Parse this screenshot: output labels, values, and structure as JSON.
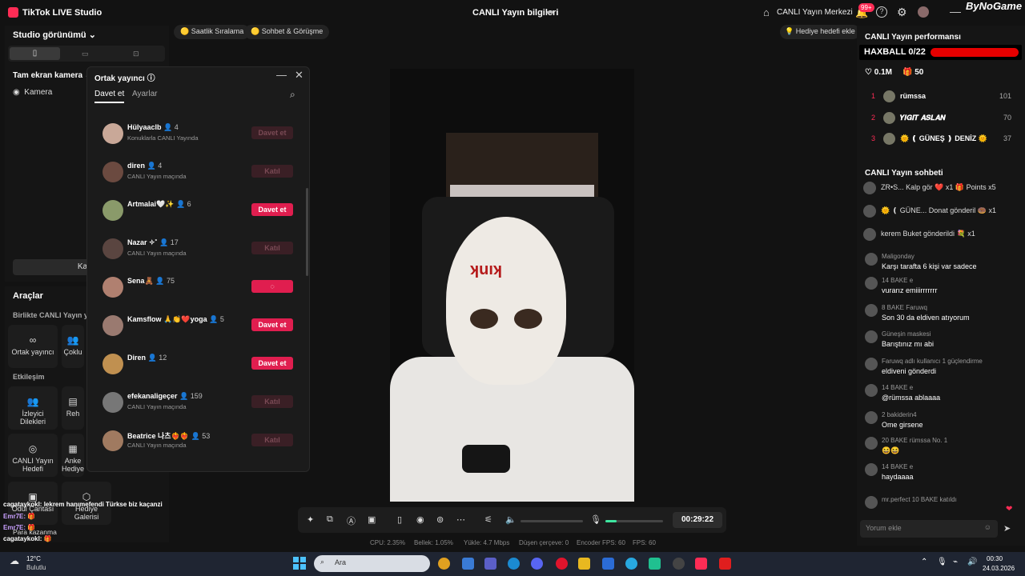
{
  "app": {
    "title": "TikTok LIVE Studio",
    "center_title": "CANLI Yayın bilgileri",
    "live_center": "CANLI Yayın Merkezi",
    "notif_badge": "99+",
    "watermark": "ByNoGame"
  },
  "left": {
    "studio_view": "Studio görünümü",
    "fullscreen_cam": "Tam ekran kamera",
    "camera": "Kamera",
    "kaynak_button": "Kaynak",
    "tools_title": "Araçlar",
    "tools_sub1": "Birlikte CANLI Yayın yap",
    "tools_sub2": "Etkileşim",
    "tool_cohost": "Ortak yayıncı",
    "tool_multi": "Çoklu",
    "tool_requests_1": "İzleyici",
    "tool_requests_2": "Dilekleri",
    "tool_reh": "Reh",
    "tool_goal_1": "CANLI Yayın",
    "tool_goal_2": "Hedefi",
    "tool_ank_1": "Anke",
    "tool_ank_2": "Hediye",
    "tool_bag": "Ödül Çantası",
    "tool_gallery_1": "Hediye",
    "tool_gallery_2": "Galerisi",
    "tool_earn": "Para kazanma"
  },
  "overlay_chat": [
    "cagataykokl: lekrem hanımefendi Türkse biz kaçanzi",
    "Emr7E: 🎁",
    "Emr7E: 🎁",
    "cagataykokl: 🎁"
  ],
  "cohost": {
    "title": "Ortak yayıncı",
    "tab_invite": "Davet et",
    "tab_settings": "Ayarlar",
    "rows": [
      {
        "name": "Hülyaaclb",
        "count": "4",
        "status": "Konuklarla CANLI Yayında",
        "button": "Davet et",
        "enabled": false,
        "color": "#c9a898"
      },
      {
        "name": "diren",
        "count": "4",
        "status": "CANLI Yayın maçında",
        "button": "Katıl",
        "enabled": false,
        "color": "#6b4a40"
      },
      {
        "name": "Artmalai🤍✨",
        "count": "6",
        "status": "",
        "button": "Davet et",
        "enabled": true,
        "color": "#8a9a6a"
      },
      {
        "name": "Nazar ✧˚",
        "count": "17",
        "status": "CANLI Yayın maçında",
        "button": "Katıl",
        "enabled": false,
        "color": "#5a4540"
      },
      {
        "name": "Sena🧸",
        "count": "75",
        "status": "",
        "button": "◌",
        "enabled": true,
        "color": "#b08070"
      },
      {
        "name": "Kamsflow 🙏👏❤️yoga",
        "count": "5",
        "status": "",
        "button": "Davet et",
        "enabled": true,
        "color": "#9a7a70"
      },
      {
        "name": "Diren",
        "count": "12",
        "status": "",
        "button": "Davet et",
        "enabled": true,
        "color": "#c09050"
      },
      {
        "name": "efekanaligeçer",
        "count": "159",
        "status": "CANLI Yayın maçında",
        "button": "Katıl",
        "enabled": false,
        "color": "#777"
      },
      {
        "name": "Beatrice 나츠❤️‍🔥❤️‍🔥",
        "count": "53",
        "status": "CANLI Yayın maçında",
        "button": "Katıl",
        "enabled": false,
        "color": "#a07a60"
      }
    ]
  },
  "pills": {
    "ranking": "Saatlik Sıralama",
    "chat": "Sohbet & Görüşme",
    "gift_goal": "Hediye hedefi ekle"
  },
  "video": {
    "text": "ʞuıʞ"
  },
  "controls": {
    "timer": "00:29:22"
  },
  "stats": {
    "cpu": "CPU: 2.35%",
    "mem": "Bellek: 1.05%",
    "upload": "Yükle: 4.7 Mbps",
    "dropped": "Düşen çerçeve: 0",
    "enc_fps": "Encoder FPS: 60",
    "fps": "FPS: 60"
  },
  "right": {
    "perf_title": "CANLI Yayın performansı",
    "haxball": "HAXBALL 0/22",
    "likes": "0.1M",
    "gifts": "50",
    "ranking": [
      {
        "rank": "1",
        "name": "rümssa",
        "score": "101"
      },
      {
        "rank": "2",
        "name": "𝒀𝑰𝑮𝑰𝑻 𝑨𝑺𝑳𝑨𝑵",
        "score": "70"
      },
      {
        "rank": "3",
        "name": "🌞 ❪ GÜNEŞ ❫ DENİZ 🌞",
        "score": "37"
      }
    ],
    "chat_title": "CANLI Yayın sohbeti",
    "gift_rows": [
      {
        "text": "ZR•S...  Kalp gör ❤️ x1   🎁 Points x5"
      },
      {
        "text": "🌞 ❪ GÜNE...  Donat gönderil 🍩 x1"
      },
      {
        "text": "kerem  Buket gönderildi 💐 x1"
      }
    ],
    "messages": [
      {
        "head": "Maligonday",
        "text": "Karşı tarafta 6 kişi var sadece"
      },
      {
        "head": "14  BAKE  e",
        "text": "vurarız emiiirrrrrrr"
      },
      {
        "head": "8  BAKE  Faruwq",
        "text": "Son 30 da eldiven atıyorum"
      },
      {
        "head": "Güneşin maskesi",
        "text": "Barıştınız mı abi"
      },
      {
        "head": "Faruwq  adlı kullanıcı 1 güçlendirme",
        "text": "eldiveni gönderdi"
      },
      {
        "head": "14  BAKE  e",
        "text": "@rümssa ablaaaa"
      },
      {
        "head": "2  bakiderin4",
        "text": "Ome girsene"
      },
      {
        "head": "20  BAKE  rümssa  No. 1",
        "text": "😆😆"
      },
      {
        "head": "14  BAKE  e",
        "text": "haydaaaa"
      },
      {
        "head": "mr.perfect  10  BAKE  katıldı",
        "text": ""
      }
    ],
    "comment_placeholder": "Yorum ekle"
  },
  "taskbar": {
    "temp": "12°C",
    "weather": "Bulutlu",
    "search": "Ara",
    "time": "00:30",
    "date": "24.03.2026"
  }
}
